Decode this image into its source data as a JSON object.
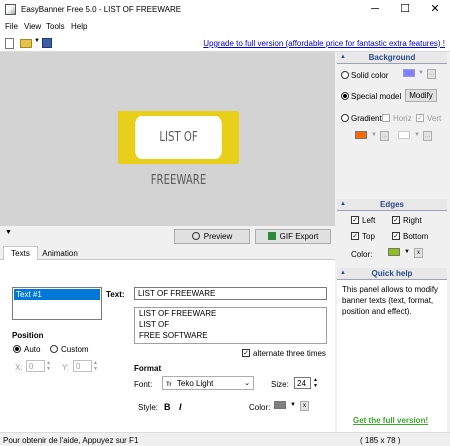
{
  "window": {
    "title": "EasyBanner Free 5.0 - LIST OF FREEWARE",
    "minimize": "─",
    "maximize": "☐",
    "close": "✕"
  },
  "menu": {
    "file": "File",
    "view": "View",
    "tools": "Tools",
    "help": "Help"
  },
  "toolbar": {
    "upgrade_link": "Upgrade to full version (affordable price for fantastic extra features) !"
  },
  "banner": {
    "text": "LIST OF FREEWARE",
    "border_color": "#e8cf19"
  },
  "preview_controls": {
    "collapse_arrow": "▼",
    "preview_button": "Preview",
    "gif_export_button": "GIF Export"
  },
  "tabs": {
    "texts": "Texts",
    "animation": "Animation"
  },
  "texts_panel": {
    "text_list": [
      "Text #1"
    ],
    "text_label": "Text:",
    "text_value": "LIST OF FREEWARE",
    "alt_lines": [
      "LIST OF FREEWARE",
      "LIST OF",
      "FREE SOFTWARE"
    ],
    "alternate_label": "alternate three times",
    "position_title": "Position",
    "auto_label": "Auto",
    "custom_label": "Custom",
    "x_label": "X:",
    "x_value": "0",
    "y_label": "Y:",
    "y_value": "0",
    "format_title": "Format",
    "font_label": "Font:",
    "font_value": "Teko Light",
    "size_label": "Size:",
    "size_value": "24",
    "style_label": "Style:",
    "bold": "B",
    "italic": "I",
    "color_label": "Color:",
    "font_color": "#808080"
  },
  "background_panel": {
    "title": "Background",
    "solid_color": "Solid color",
    "solid_swatch": "#8080ff",
    "special_model": "Special model",
    "modify_button": "Modify",
    "gradient": "Gradient",
    "horiz": "Horiz",
    "vert": "Vert",
    "gradient_color1": "#ff6a00",
    "gradient_color2": "#ffffff"
  },
  "edges_panel": {
    "title": "Edges",
    "left": "Left",
    "right": "Right",
    "top": "Top",
    "bottom": "Bottom",
    "color_label": "Color:",
    "edge_color": "#8fbf1f",
    "x_button": "x"
  },
  "quick_help": {
    "title": "Quick help",
    "body": "This panel allows to modify banner texts (text, format, position and effect).",
    "full_version_link": "Get the full version!"
  },
  "status": {
    "left": "Pour obtenir de l'aide, Appuyez sur F1",
    "right": "( 185 x 78 )"
  }
}
